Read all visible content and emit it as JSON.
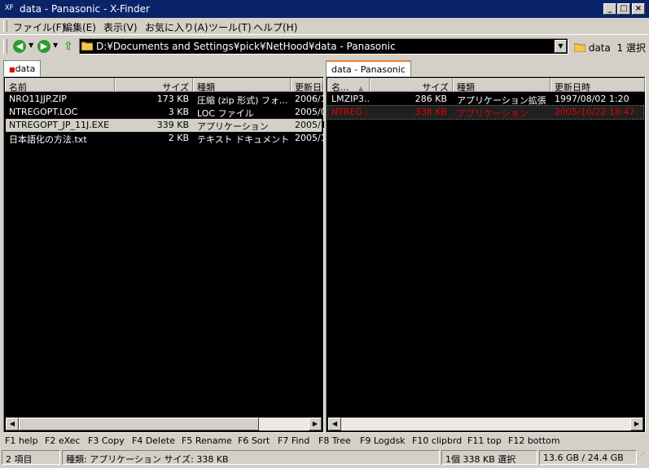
{
  "window": {
    "title": "data - Panasonic - X-Finder",
    "icon": "x-finder-logo"
  },
  "menu": {
    "items": [
      "ファイル(F)",
      "編集(E)",
      "表示(V)",
      "お気に入り(A)",
      "ツール(T)",
      "ヘルプ(H)"
    ]
  },
  "address": {
    "path": "D:¥Documents and Settings¥pick¥NetHood¥data - Panasonic",
    "folder_label": "data",
    "selection_text": "1 選択"
  },
  "left_pane": {
    "tab": "data",
    "columns": [
      "名前",
      "サイズ",
      "種類",
      "更新日時"
    ],
    "rows": [
      {
        "name": "NRO11JJP.ZIP",
        "size": "173 KB",
        "type": "圧縮 (zip 形式) フォ...",
        "date": "2006/1"
      },
      {
        "name": "NTREGOPT.LOC",
        "size": "3 KB",
        "type": "LOC ファイル",
        "date": "2005/0"
      },
      {
        "name": "NTREGOPT_JP_11J.EXE",
        "size": "339 KB",
        "type": "アプリケーション",
        "date": "2005/1"
      },
      {
        "name": "日本語化の方法.txt",
        "size": "2 KB",
        "type": "テキスト ドキュメント",
        "date": "2005/1"
      }
    ],
    "selected_index": 2
  },
  "right_pane": {
    "tab": "data - Panasonic",
    "columns": [
      "名...",
      "サイズ",
      "種類",
      "更新日時"
    ],
    "rows": [
      {
        "name": "LMZIP3...",
        "size": "286 KB",
        "type": "アプリケーション拡張",
        "date": "1997/08/02 1:20"
      },
      {
        "name": "NTREG...",
        "size": "338 KB",
        "type": "アプリケーション",
        "date": "2005/10/22 18:47"
      }
    ],
    "marked_index": 1
  },
  "function_keys": [
    "F1 help",
    "F2 eXec",
    "F3 Copy",
    "F4 Delete",
    "F5 Rename",
    "F6 Sort",
    "F7 Find",
    "F8 Tree",
    "F9 Logdsk",
    "F10 clipbrd",
    "F11 top",
    "F12 bottom"
  ],
  "status": {
    "items": "2 項目",
    "info": "種類: アプリケーション サイズ: 338 KB",
    "selection": "1個 338 KB 選択",
    "disk": "13.6 GB / 24.4 GB"
  },
  "colors": {
    "title_bg": "#0a246a",
    "face": "#d4d0c8",
    "list_bg": "#000000",
    "marked": "#e00000",
    "tab_accent": "#f08030"
  }
}
